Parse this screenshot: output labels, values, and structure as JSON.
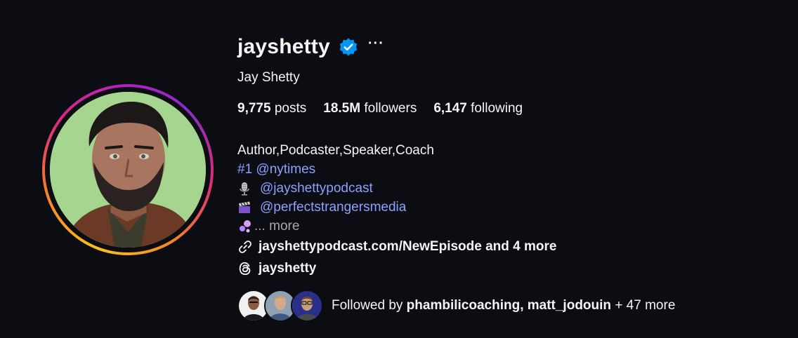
{
  "profile": {
    "username": "jayshetty",
    "full_name": "Jay Shetty",
    "more_label": "···",
    "stats": {
      "posts_count": "9,775",
      "posts_label": "posts",
      "followers_count": "18.5M",
      "followers_label": "followers",
      "following_count": "6,147",
      "following_label": "following"
    },
    "bio": {
      "line1": "Author,Podcaster,Speaker,Coach",
      "line2": "#1 @nytimes",
      "line3": "@jayshettypodcast",
      "line4": "@perfectstrangersmedia",
      "more": "... more"
    },
    "link": "jayshettypodcast.com/NewEpisode and 4 more",
    "threads_handle": "jayshetty",
    "followed_by": {
      "prefix": "Followed by",
      "names": "phambilicoaching, matt_jodouin",
      "suffix": "+ 47 more"
    }
  },
  "colors": {
    "background": "#0b0d12",
    "verified": "#0095f6",
    "link_blue": "#8ea0ff",
    "avatar_bg": "#a5d58f"
  },
  "icons": [
    "verified-badge-icon",
    "more-options-icon",
    "microphone-icon",
    "clapper-icon",
    "sparkle-icon",
    "link-icon",
    "threads-icon"
  ]
}
